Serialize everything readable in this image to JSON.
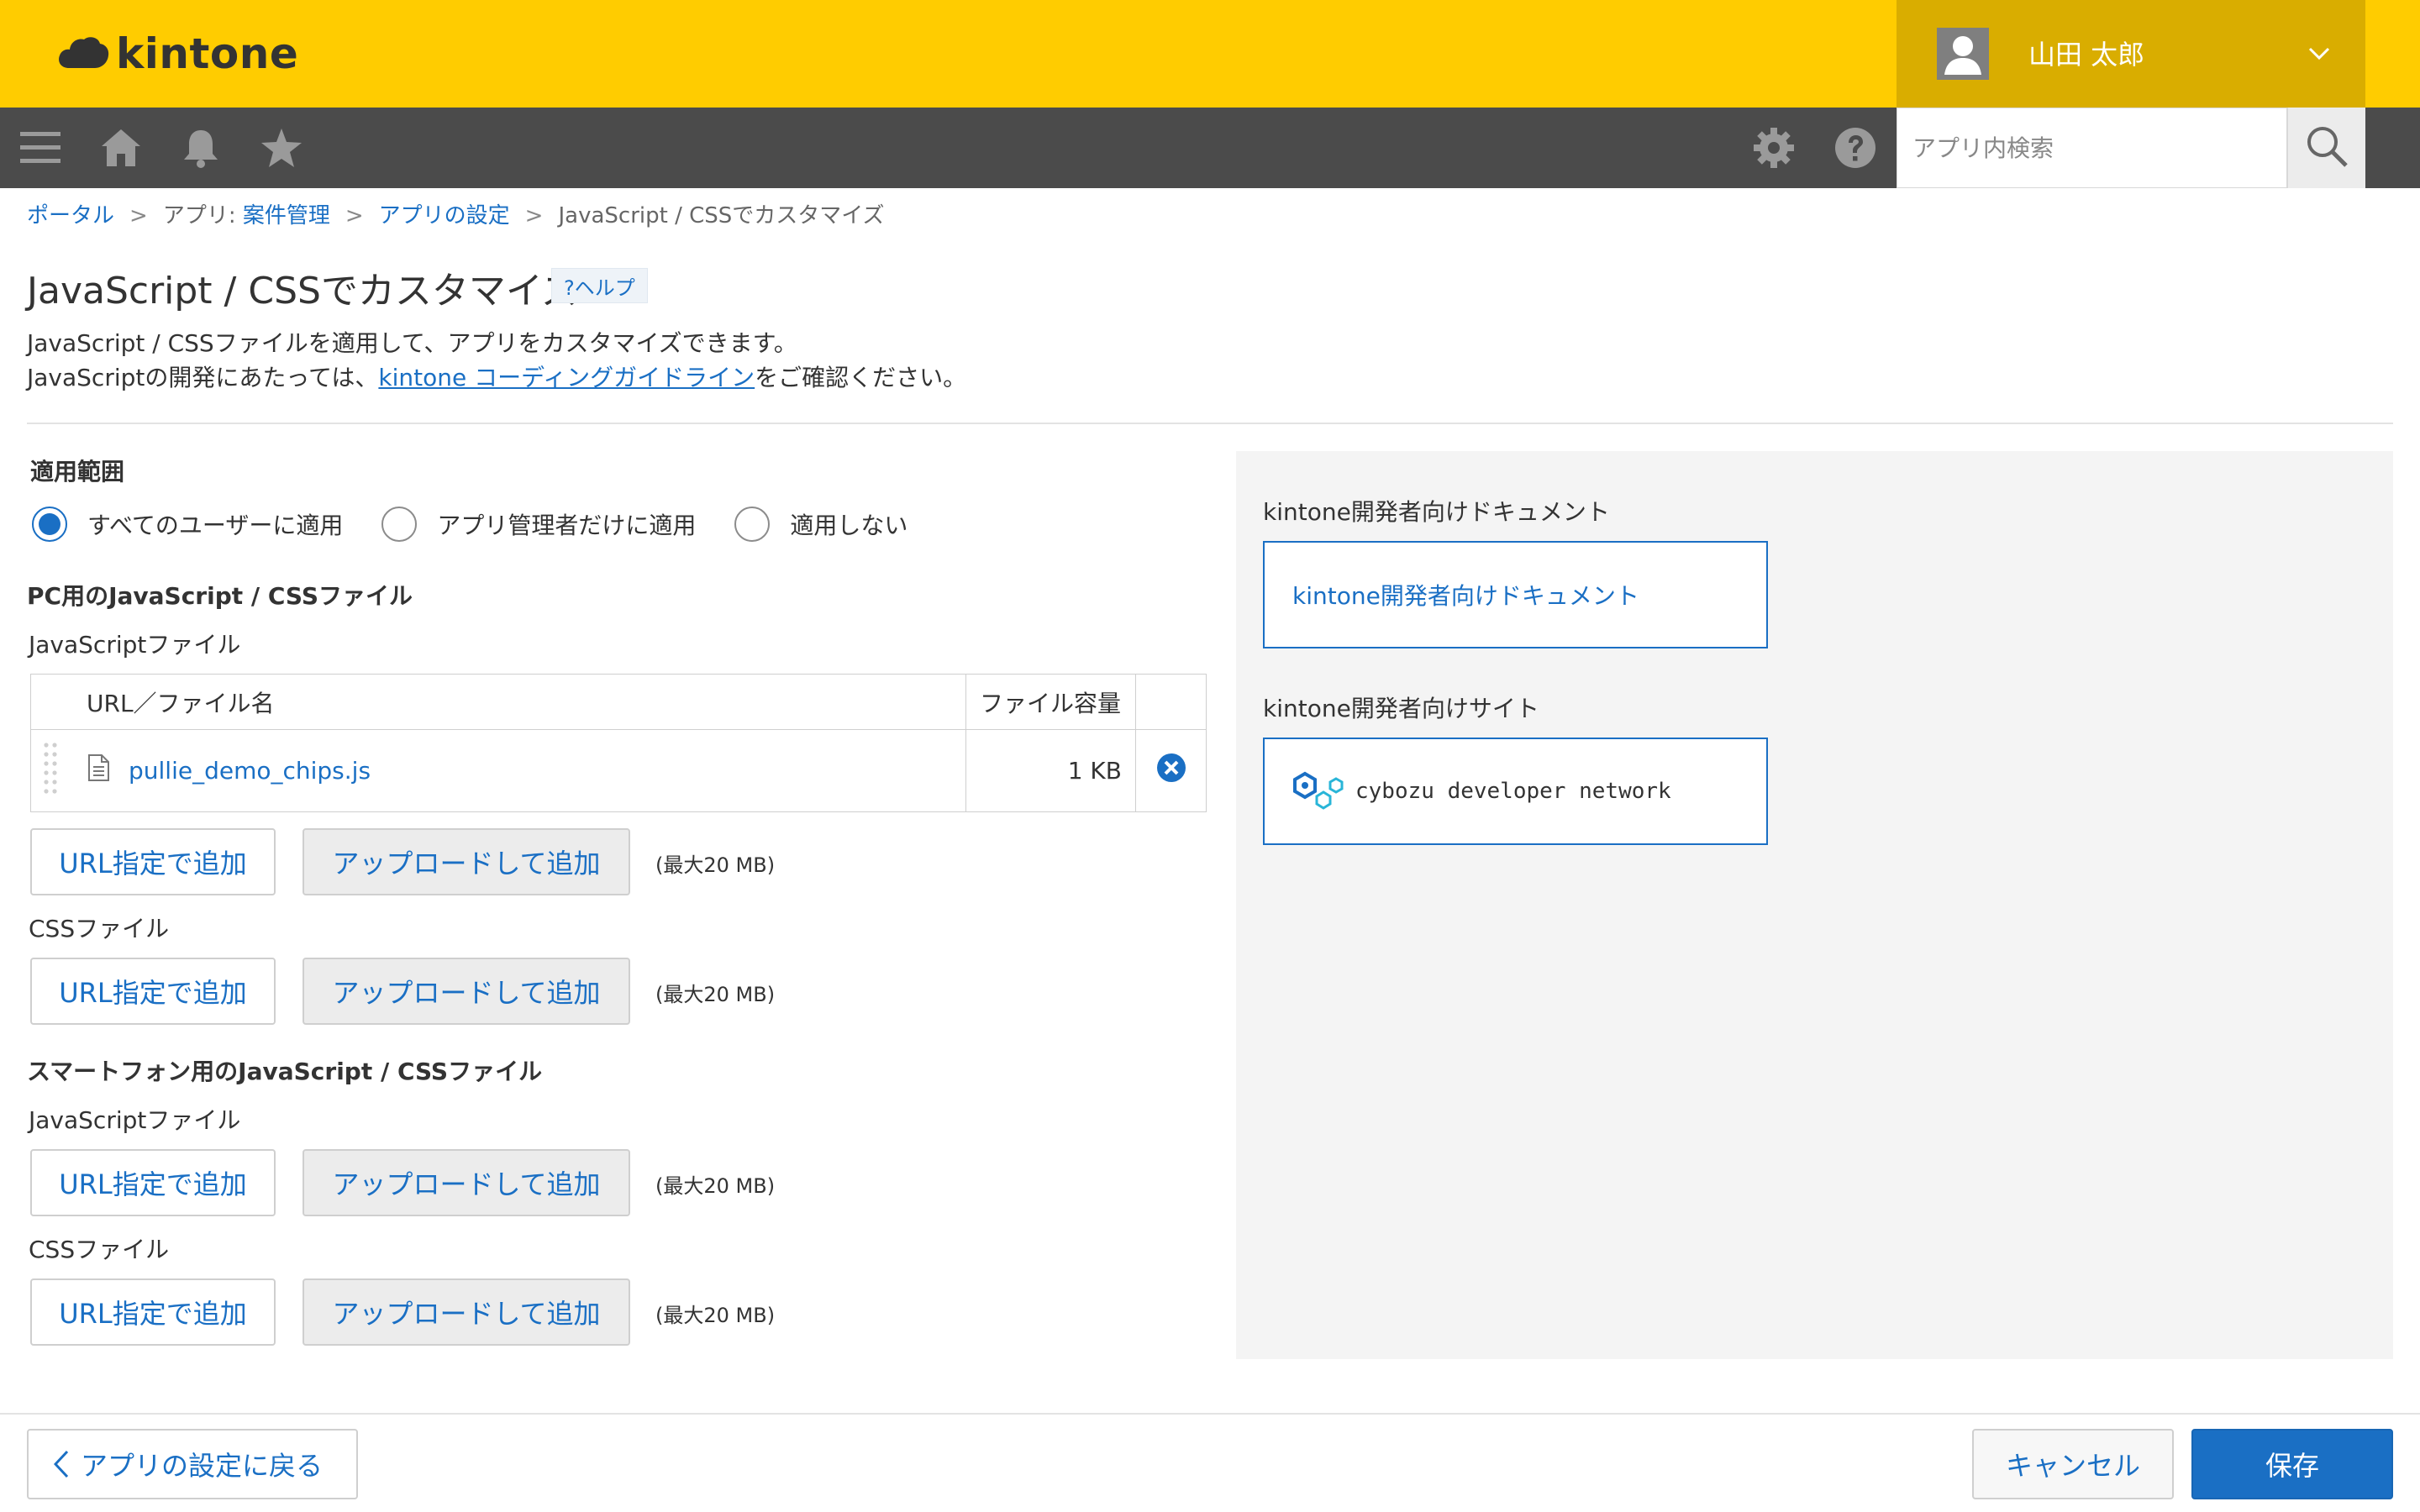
{
  "header": {
    "brand": "kintone",
    "user_name": "山田 太郎"
  },
  "navbar": {
    "icons": [
      "menu-icon",
      "home-icon",
      "bell-icon",
      "star-icon",
      "gear-icon",
      "help-icon",
      "search-icon"
    ],
    "search_placeholder": "アプリ内検索"
  },
  "breadcrumb": {
    "portal": "ポータル",
    "app_prefix": "アプリ: ",
    "app_name": "案件管理",
    "settings": "アプリの設定",
    "current": "JavaScript / CSSでカスタマイズ",
    "separator": ">"
  },
  "page": {
    "title": "JavaScript / CSSでカスタマイズ",
    "help_label": "?ヘルプ",
    "desc_line1": "JavaScript / CSSファイルを適用して、アプリをカスタマイズできます。",
    "desc_line2_prefix": "JavaScriptの開発にあたっては、",
    "desc_line2_link": "kintone コーディングガイドライン",
    "desc_line2_suffix": "をご確認ください。"
  },
  "scope": {
    "heading": "適用範囲",
    "options": [
      "すべてのユーザーに適用",
      "アプリ管理者だけに適用",
      "適用しない"
    ],
    "selected": "すべてのユーザーに適用"
  },
  "pc_section": {
    "heading": "PC用のJavaScript / CSSファイル",
    "js_label": "JavaScriptファイル",
    "css_label": "CSSファイル",
    "table": {
      "col_name": "URL／ファイル名",
      "col_size": "ファイル容量",
      "rows": [
        {
          "name": "pullie_demo_chips.js",
          "size": "1 KB"
        }
      ]
    }
  },
  "sp_section": {
    "heading": "スマートフォン用のJavaScript / CSSファイル",
    "js_label": "JavaScriptファイル",
    "css_label": "CSSファイル"
  },
  "buttons": {
    "add_url": "URL指定で追加",
    "upload": "アップロードして追加",
    "max_size": "(最大20 MB)"
  },
  "sidebar": {
    "docs_heading": "kintone開発者向けドキュメント",
    "docs_link": "kintone開発者向けドキュメント",
    "site_heading": "kintone開発者向けサイト",
    "site_link": "cybozu developer network"
  },
  "footer": {
    "back": "アプリの設定に戻る",
    "cancel": "キャンセル",
    "save": "保存"
  },
  "colors": {
    "header_yellow": "#ffcc00",
    "user_area": "#d9ad00",
    "navbar": "#4b4b4b",
    "link_blue": "#1a6fc4",
    "panel_gray": "#f4f4f4"
  }
}
